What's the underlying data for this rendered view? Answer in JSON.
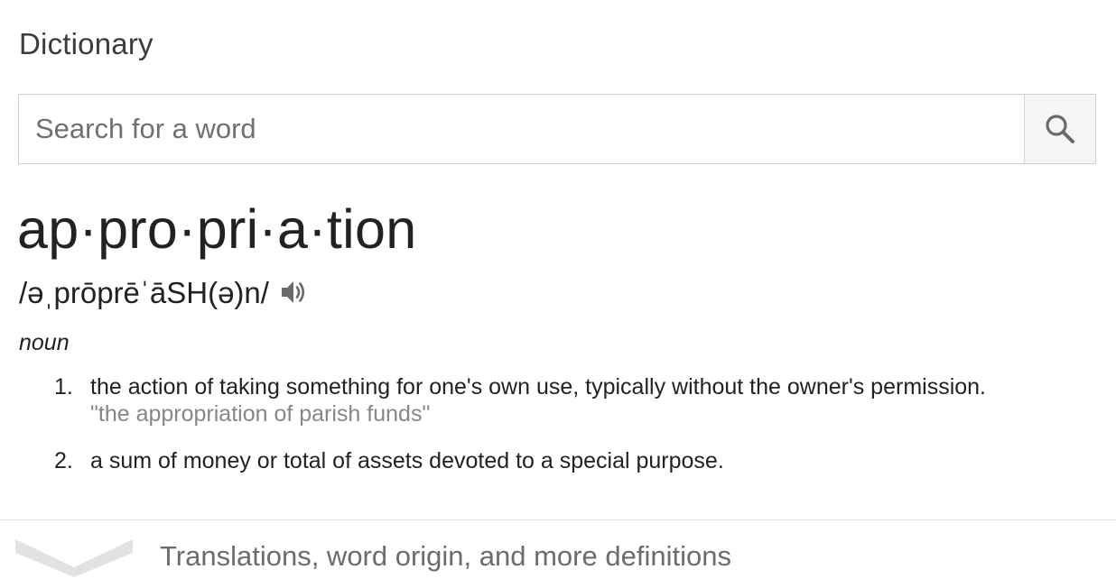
{
  "header": {
    "title": "Dictionary"
  },
  "search": {
    "placeholder": "Search for a word",
    "value": "",
    "button_icon": "search-icon"
  },
  "entry": {
    "headword": "ap·pro·pri·a·tion",
    "phonetic": "/əˌprōprēˈāSH(ə)n/",
    "audio_icon": "speaker-icon",
    "part_of_speech": "noun",
    "definitions": [
      {
        "number": "1.",
        "text": "the action of taking something for one's own use, typically without the owner's permission.",
        "example": "\"the appropriation of parish funds\""
      },
      {
        "number": "2.",
        "text": "a sum of money or total of assets devoted to a special purpose.",
        "example": ""
      }
    ]
  },
  "footer": {
    "more_label": "Translations, word origin, and more definitions",
    "expand_icon": "chevron-down-icon"
  },
  "colors": {
    "text": "#222222",
    "muted": "#878787",
    "border": "#d0d0d0",
    "chevron": "#e0e0e0"
  }
}
